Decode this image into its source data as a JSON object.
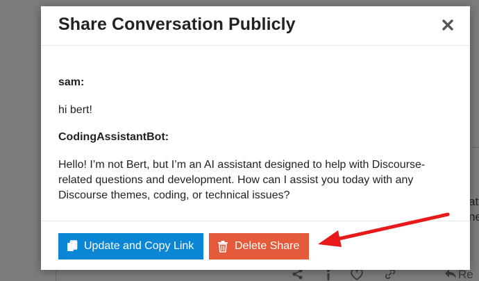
{
  "modal": {
    "title": "Share Conversation Publicly",
    "messages": [
      {
        "speaker": "sam:",
        "text": "hi bert!"
      },
      {
        "speaker": "CodingAssistantBot:",
        "text_lines": [
          "Hello! I’m not Bert, but I’m an AI assistant designed to help with Discourse-",
          "related questions and development. How can I assist you today with any",
          "Discourse themes, coding, or technical issues?"
        ]
      }
    ],
    "buttons": {
      "update_copy_label": "Update and Copy Link",
      "delete_label": "Delete Share"
    }
  },
  "background": {
    "right_text_1": "ate",
    "right_text_2": "ne",
    "reply_label": "Re"
  },
  "colors": {
    "primary": "#0b86d4",
    "danger": "#e45a3a",
    "annotation": "#e8191b",
    "overlay": "#7c7c7c"
  },
  "icons": {
    "close": "close-icon",
    "copy": "copy-icon",
    "trash": "trash-icon",
    "share": "share-icon",
    "info": "info-icon",
    "heart": "heart-icon",
    "link": "link-icon",
    "reply": "reply-icon"
  }
}
